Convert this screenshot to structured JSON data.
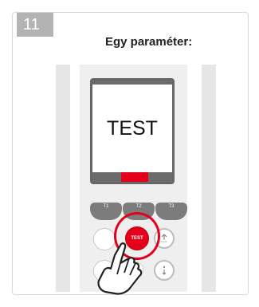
{
  "step": {
    "number": "11"
  },
  "caption": {
    "text": "Egy paraméter:"
  },
  "display": {
    "text": "TEST"
  },
  "function_keys": [
    {
      "label": "T1"
    },
    {
      "label": "T2"
    },
    {
      "label": "T3"
    }
  ],
  "buttons": {
    "test_label": "TEST"
  },
  "colors": {
    "accent_red": "#e4001b",
    "badge_gray": "#b3b3b3",
    "device_gray": "#efefef"
  },
  "icons": {
    "up": "arrow-up-icon",
    "info": "info-icon",
    "hand": "pointing-hand-icon"
  }
}
